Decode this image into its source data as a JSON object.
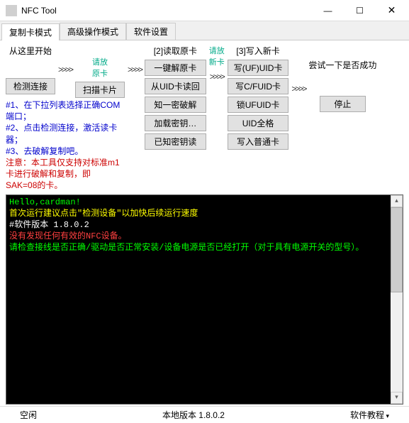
{
  "title": "NFC Tool",
  "winbtns": {
    "min": "—",
    "max": "☐",
    "close": "✕"
  },
  "tabs": [
    "复制卡模式",
    "高级操作模式",
    "软件设置"
  ],
  "section1": {
    "head": "从这里开始",
    "btn": "检测连接"
  },
  "section1b": {
    "sub1": "请放",
    "sub2": "原卡",
    "btn": "扫描卡片"
  },
  "section2": {
    "head": "[2]读取原卡",
    "btns": [
      "一键解原卡",
      "从UID卡读回",
      "知一密破解",
      "加载密钥…",
      "已知密钥读"
    ]
  },
  "section2r": {
    "sub1": "请放",
    "sub2": "新卡"
  },
  "section3": {
    "head": "[3]写入新卡",
    "btns": [
      "写(UF)UID卡",
      "写C/FUID卡",
      "锁UFUID卡",
      "UID全格",
      "写入普通卡"
    ]
  },
  "last": {
    "try": "尝试一下是否成功",
    "stop": "停止"
  },
  "arrows": ">>>>",
  "notes": {
    "l1": "#1、在下拉列表选择正确COM端口；",
    "l2": "#2、点击检测连接，激活读卡器；",
    "l3": "#3、去破解复制吧。",
    "l4": "注意：本工具仅支持对标准m1卡进行破解和复制，即SAK=08的卡。"
  },
  "console": {
    "l1": "Hello,cardman!",
    "l2": "首次运行建议点击\"检测设备\"以加快后续运行速度",
    "l3": "#软件版本 1.8.0.2",
    "l4": "没有发现任何有效的NFC设备。",
    "l5": "请检查接线是否正确/驱动是否正常安装/设备电源是否已经打开（对于具有电源开关的型号）。"
  },
  "status": {
    "left": "空闲",
    "center": "本地版本 1.8.0.2",
    "right": "软件教程"
  }
}
